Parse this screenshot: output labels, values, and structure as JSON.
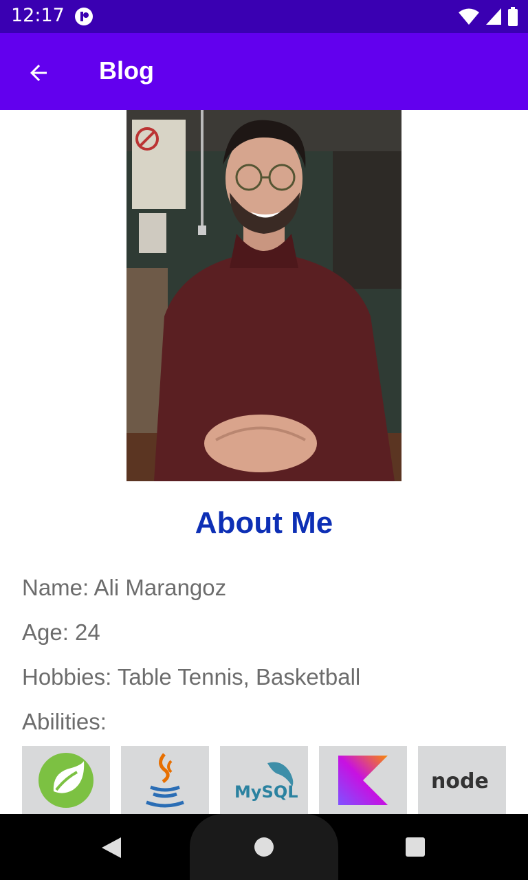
{
  "status_bar": {
    "time": "12:17",
    "icons": [
      "app-notification-icon",
      "wifi-icon",
      "cell-signal-icon",
      "battery-icon"
    ]
  },
  "app_bar": {
    "title": "Blog",
    "back_icon": "arrow-back-icon",
    "color": "#6200ee"
  },
  "profile": {
    "photo": "profile-photo"
  },
  "about": {
    "title": "About Me",
    "name_line": "Name: Ali Marangoz",
    "age_line": "Age: 24",
    "hobbies_line": "Hobbies: Table Tennis, Basketball",
    "abilities_label": "Abilities:",
    "abilities": [
      {
        "icon": "spring-logo-icon"
      },
      {
        "icon": "java-logo-icon"
      },
      {
        "icon": "mysql-logo-icon",
        "text": "MySQL"
      },
      {
        "icon": "kotlin-logo-icon"
      },
      {
        "icon": "nodejs-logo-icon",
        "text": "node"
      }
    ]
  },
  "nav_bar": {
    "buttons": [
      "back-triangle-icon",
      "home-circle-icon",
      "recents-square-icon"
    ]
  },
  "colors": {
    "status_bar": "#3a00b2",
    "app_bar": "#6200ee",
    "heading": "#0d2fb5",
    "body_text": "#6c6c6c",
    "tile_bg": "#d8d9da"
  }
}
